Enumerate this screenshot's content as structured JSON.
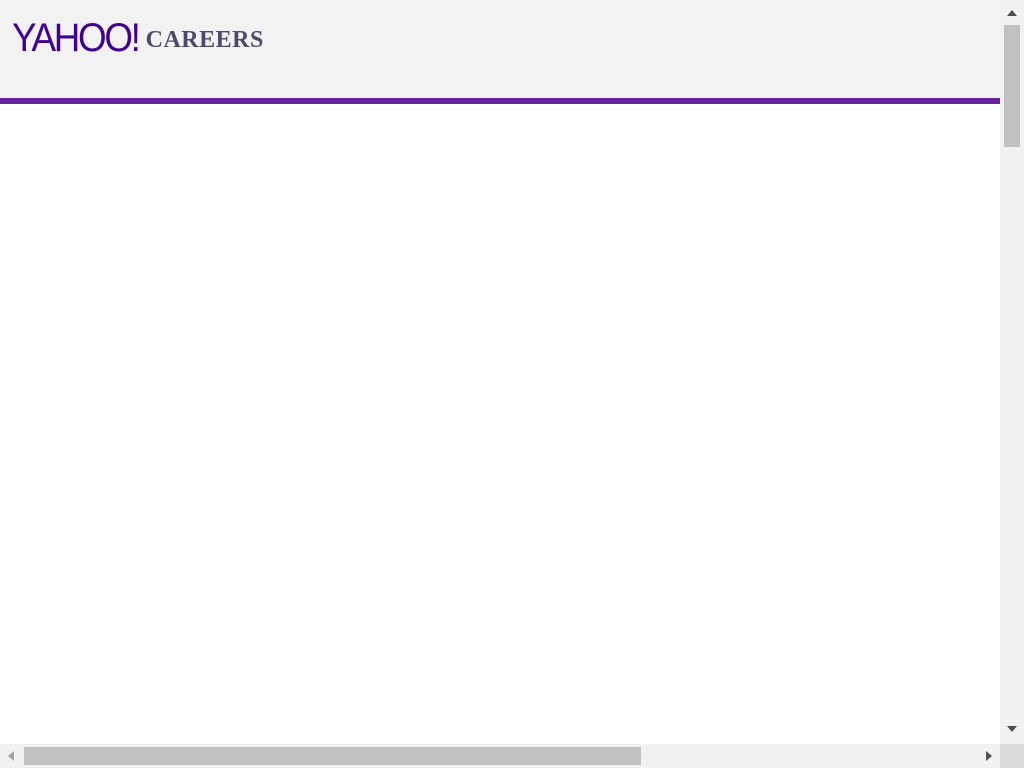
{
  "header": {
    "logo_text": "YAHOO!",
    "logo_subtitle": "CAREERS"
  },
  "colors": {
    "brand_purple": "#400090",
    "subtitle_slate": "#4c4a6b",
    "accent_rule": "#6b1f9a",
    "header_background": "#f2f2f2",
    "page_background": "#ffffff"
  },
  "icons": {
    "scroll_up": "chevron-up-icon",
    "scroll_down": "chevron-down-icon",
    "scroll_left": "chevron-left-icon",
    "scroll_right": "chevron-right-icon"
  }
}
